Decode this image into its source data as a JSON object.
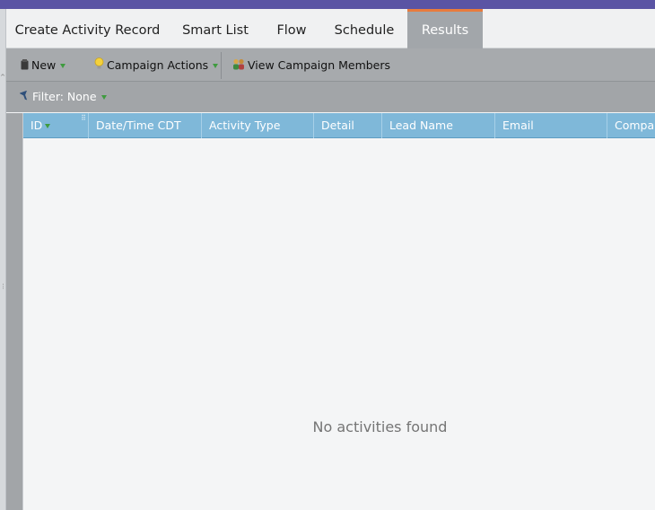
{
  "tabs": [
    {
      "label": "Create Activity Record",
      "active": false
    },
    {
      "label": "Smart List",
      "active": false
    },
    {
      "label": "Flow",
      "active": false
    },
    {
      "label": "Schedule",
      "active": false
    },
    {
      "label": "Results",
      "active": true
    }
  ],
  "toolbar": {
    "new_label": "New",
    "campaign_actions_label": "Campaign Actions",
    "view_members_label": "View Campaign Members"
  },
  "filter": {
    "label": "Filter: None"
  },
  "grid": {
    "columns": [
      "ID",
      "Date/Time CDT",
      "Activity Type",
      "Detail",
      "Lead Name",
      "Email",
      "Company"
    ],
    "empty_message": "No activities found"
  },
  "colors": {
    "accent": "#e87b3c",
    "header_blue": "#7fb8d9",
    "top_bar": "#5a54a4"
  }
}
